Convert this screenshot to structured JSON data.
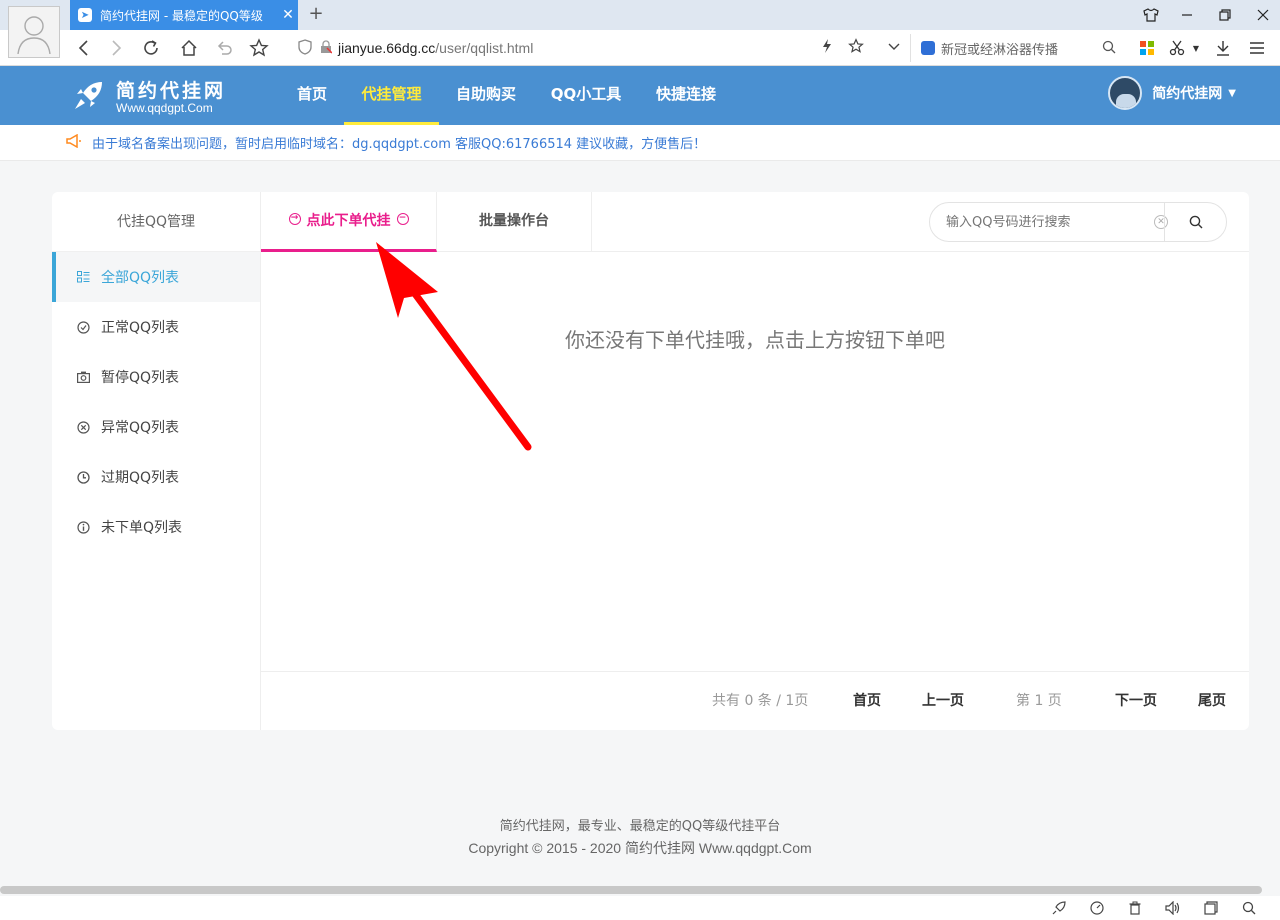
{
  "browser": {
    "tab_title": "简约代挂网 - 最稳定的QQ等级",
    "tab_close": "✕",
    "new_tab": "+",
    "url_host": "jianyue.66dg.cc",
    "url_path": "/user/qqlist.html",
    "search_placeholder": "新冠或经淋浴器传播"
  },
  "site": {
    "logo_title": "简约代挂网",
    "logo_sub": "Www.qqdgpt.Com",
    "nav": [
      "首页",
      "代挂管理",
      "自助购买",
      "QQ小工具",
      "快捷连接"
    ],
    "active_nav": "代挂管理",
    "username": "简约代挂网",
    "notice": "由于域名备案出现问题，暂时启用临时域名：dg.qqdgpt.com 客服QQ:61766514 建议收藏，方便售后！"
  },
  "sidebar": {
    "title": "代挂QQ管理",
    "items": [
      {
        "label": "全部QQ列表",
        "icon": "grid-list-icon"
      },
      {
        "label": "正常QQ列表",
        "icon": "check-circle-icon"
      },
      {
        "label": "暂停QQ列表",
        "icon": "camera-icon"
      },
      {
        "label": "异常QQ列表",
        "icon": "x-circle-icon"
      },
      {
        "label": "过期QQ列表",
        "icon": "clock-icon"
      },
      {
        "label": "未下单Q列表",
        "icon": "info-circle-icon"
      }
    ]
  },
  "main": {
    "tab_order": "点此下单代挂",
    "tab_batch": "批量操作台",
    "search_placeholder": "输入QQ号码进行搜索",
    "empty_text": "你还没有下单代挂哦，点击上方按钮下单吧"
  },
  "pager": {
    "total": "共有 0 条 / 1页",
    "first": "首页",
    "prev": "上一页",
    "current": "第 1 页",
    "next": "下一页",
    "last": "尾页"
  },
  "footer": {
    "line1": "简约代挂网，最专业、最稳定的QQ等级代挂平台",
    "line2": "Copyright © 2015 - 2020 简约代挂网 Www.qqdgpt.Com"
  },
  "colors": {
    "header": "#4a90d1",
    "active_nav": "#ffeb3b",
    "accent_pink": "#e91e8c",
    "sidebar_active": "#3ba6d8",
    "annotation_arrow": "#ff0000"
  }
}
